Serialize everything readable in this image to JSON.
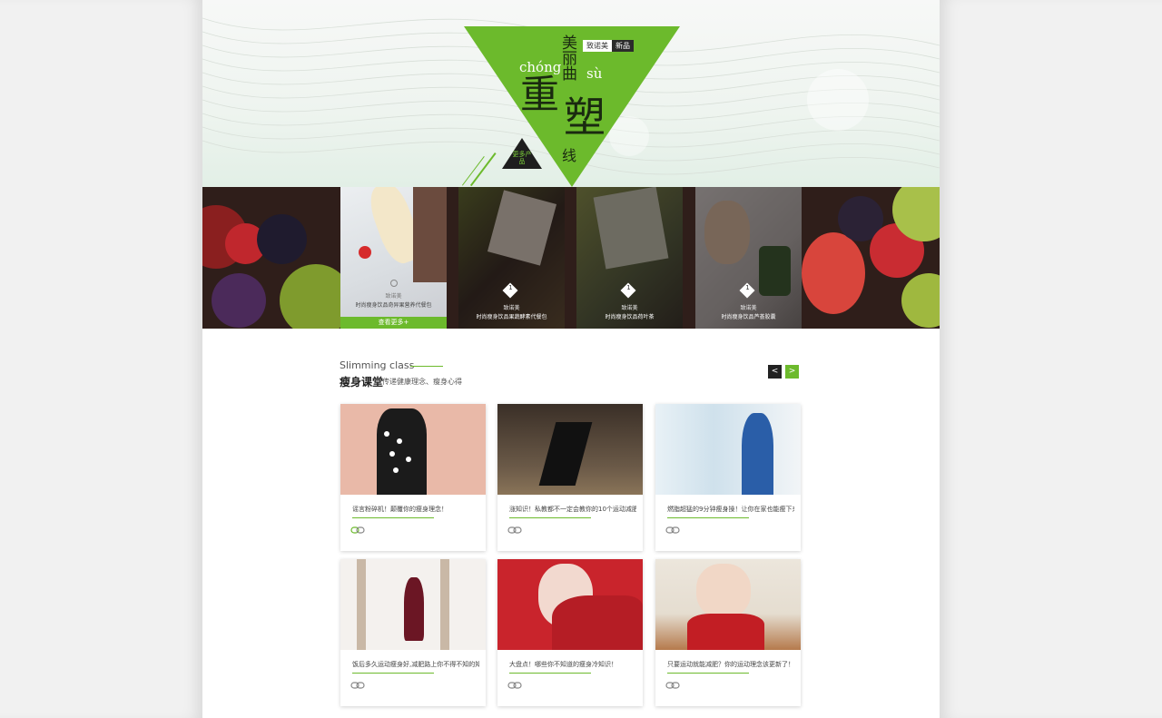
{
  "hero": {
    "title_meili": "美丽曲",
    "pinyin_chong": "chóng",
    "pinyin_su": "sù",
    "title_zhong": "重",
    "title_su": "塑",
    "title_xian": "线",
    "tag_brand": "致诺美",
    "tag_new": "新品",
    "more_products": "更多产品",
    "accent_color": "#6cba2c"
  },
  "products": [
    {
      "brand": "致诺美",
      "desc": "时尚瘦身饮品奇异果营养代餐包",
      "more": "查看更多+",
      "active": true
    },
    {
      "brand": "致诺美",
      "desc": "时尚瘦身饮品果蔬酵素代餐包",
      "index": "1"
    },
    {
      "brand": "致诺美",
      "desc": "时尚瘦身饮品荷叶茶",
      "index": "1"
    },
    {
      "brand": "致诺美",
      "desc": "时尚瘦身饮品芦荟胶囊",
      "index": "1"
    }
  ],
  "section": {
    "title_en": "Slimming class",
    "title_cn": "瘦身课堂",
    "subtitle": "传递健康理念、瘦身心得",
    "prev": "<",
    "next": ">"
  },
  "articles": [
    {
      "title": "谣言粉碎机！颠覆你的瘦身理念！",
      "icon": "link-icon"
    },
    {
      "title": "涨知识！私教都不一定会教你的10个运动减肥误...",
      "icon": "link-icon"
    },
    {
      "title": "燃脂超猛的9分钟瘦身操！让你在家也能瘦下来...",
      "icon": "link-icon"
    },
    {
      "title": "饭后多久运动瘦身好,减肥路上你不得不知的知识",
      "icon": "link-icon"
    },
    {
      "title": "大盘点！哪些你不知道的瘦身冷知识！",
      "icon": "link-icon"
    },
    {
      "title": "只要运动就能减肥？你的运动理念该更新了！",
      "icon": "link-icon"
    }
  ]
}
